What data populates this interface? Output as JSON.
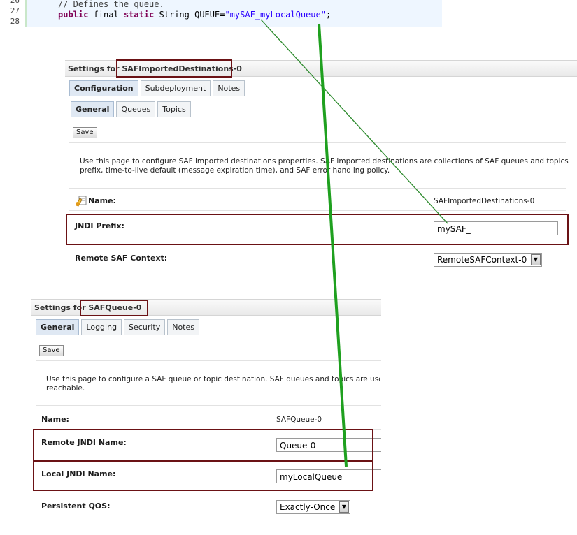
{
  "code": {
    "lines": [
      {
        "num": "26",
        "text": ""
      },
      {
        "num": "27",
        "comment": "// Defines the queue."
      },
      {
        "num": "28",
        "kw": "public",
        "plain": " final ",
        "kw2": "static",
        "plain2": " String QUEUE=",
        "str": "\"mySAF_myLocalQueue\"",
        "end": ";"
      }
    ]
  },
  "imported": {
    "title_prefix": "Settings for ",
    "title_name": "SAFImportedDestinations-0",
    "tabs": [
      "Configuration",
      "Subdeployment",
      "Notes"
    ],
    "subtabs": [
      "General",
      "Queues",
      "Topics"
    ],
    "save": "Save",
    "desc_line1": "Use this page to configure SAF imported destinations properties. SAF imported destinations are collections of SAF queues and topics that local",
    "desc_line2": "prefix, time-to-live default (message expiration time), and SAF error handling policy.",
    "name_label": "Name:",
    "name_value": "SAFImportedDestinations-0",
    "jndi_prefix_label": "JNDI Prefix:",
    "jndi_prefix_value": "mySAF_",
    "remote_ctx_label": "Remote SAF Context:",
    "remote_ctx_value": "RemoteSAFContext-0"
  },
  "queue": {
    "title_prefix": "Settings for ",
    "title_name": "SAFQueue-0",
    "tabs": [
      "General",
      "Logging",
      "Security",
      "Notes"
    ],
    "save": "Save",
    "desc_line1": "Use this page to configure a SAF queue or topic destination. SAF queues and topics are used for as",
    "desc_line2": "reachable.",
    "name_label": "Name:",
    "name_value": "SAFQueue-0",
    "remote_jndi_label": "Remote JNDI Name:",
    "remote_jndi_value": "Queue-0",
    "local_jndi_label": "Local JNDI Name:",
    "local_jndi_value": "myLocalQueue",
    "qos_label": "Persistent QOS:",
    "qos_value": "Exactly-Once"
  },
  "colors": {
    "highlight": "#6b1215",
    "connector_thin": "#2e8b2e",
    "connector_thick": "#1fa01f"
  },
  "icons": [
    "info-edit-icon",
    "dropdown-arrow-icon"
  ]
}
